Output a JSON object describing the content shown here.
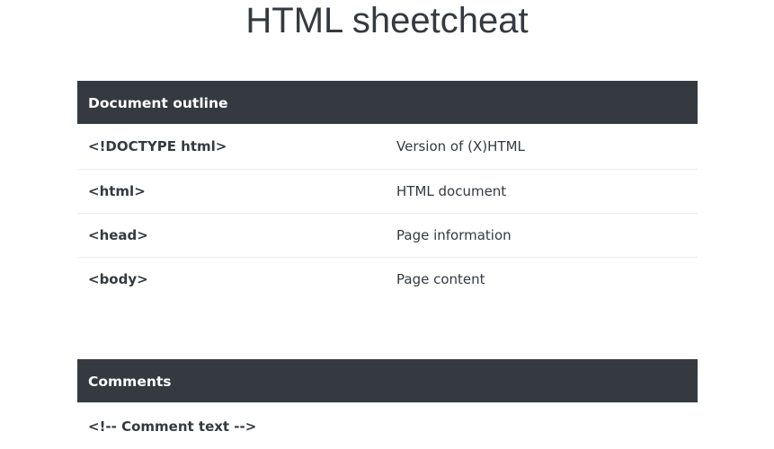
{
  "page": {
    "title": "HTML sheetcheat"
  },
  "sections": [
    {
      "heading": "Document outline",
      "rows": [
        {
          "tag": "<!DOCTYPE html>",
          "description": "Version of (X)HTML"
        },
        {
          "tag": "<html>",
          "description": "HTML document"
        },
        {
          "tag": "<head>",
          "description": "Page information"
        },
        {
          "tag": "<body>",
          "description": "Page content"
        }
      ]
    },
    {
      "heading": "Comments",
      "rows": [
        {
          "tag": "<!-- Comment text -->",
          "description": ""
        }
      ]
    }
  ],
  "colors": {
    "header_bg": "#343a40",
    "text": "#343a40",
    "row_divider": "#e9ecef"
  }
}
